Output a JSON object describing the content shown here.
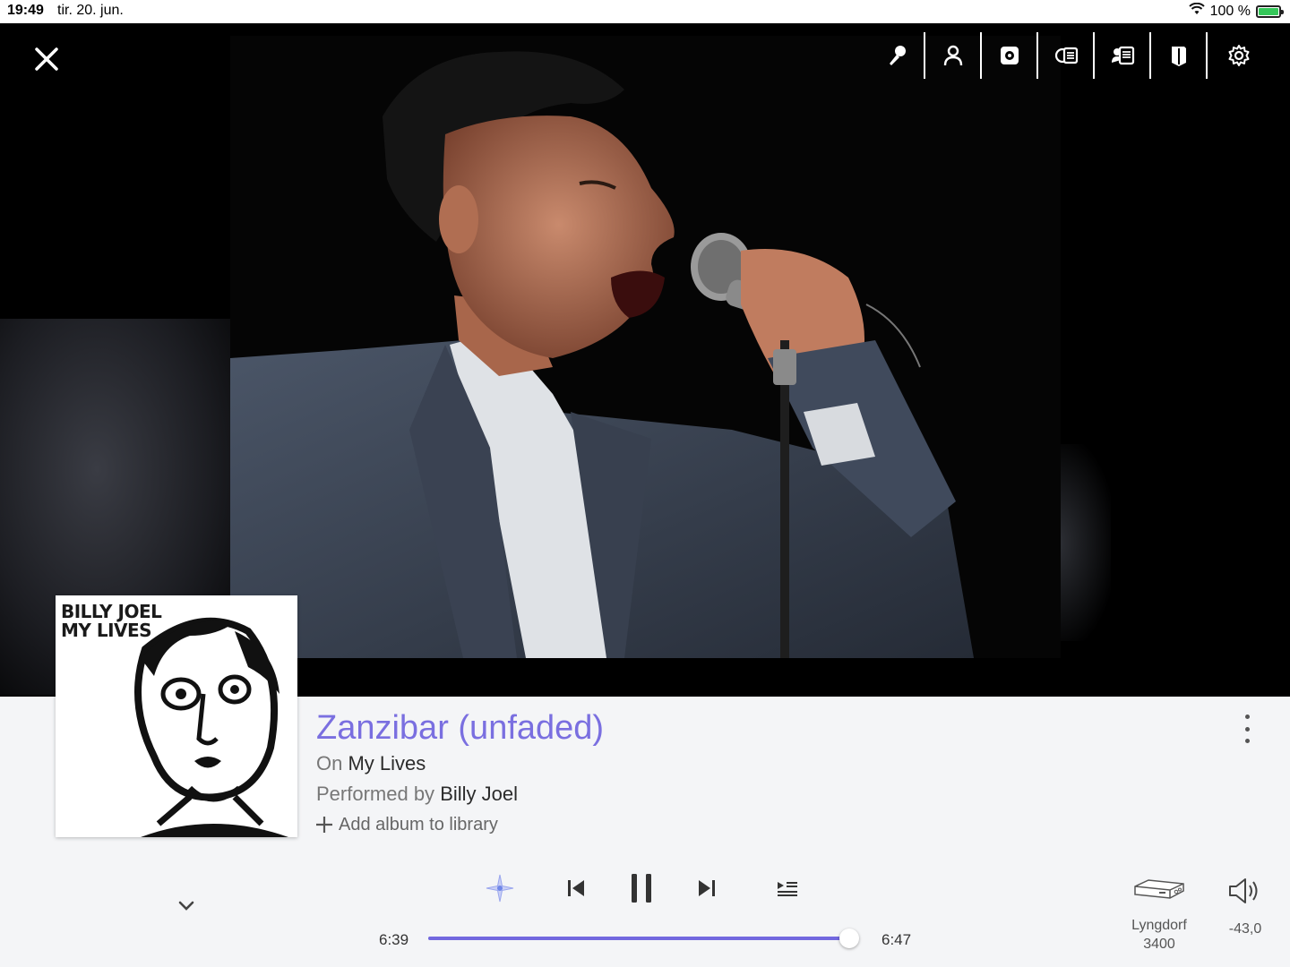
{
  "status_bar": {
    "time": "19:49",
    "date": "tir. 20. jun.",
    "battery_text": "100 %",
    "battery_level": 1.0
  },
  "toolbar": {
    "icons": [
      "microphone-icon",
      "person-icon",
      "speaker-icon",
      "album-info-icon",
      "credits-icon",
      "bookmark-icon",
      "gear-icon"
    ]
  },
  "album_cover": {
    "text_line1": "BILLY JOEL",
    "text_line2": "MY LIVES"
  },
  "track": {
    "title": "Zanzibar (unfaded)",
    "on_prefix": "On",
    "album": "My Lives",
    "performed_prefix": "Performed by",
    "artist": "Billy Joel",
    "add_album_label": "Add album to library"
  },
  "playback": {
    "elapsed": "6:39",
    "total": "6:47",
    "progress": 0.98,
    "state": "playing"
  },
  "output": {
    "device_line1": "Lyngdorf",
    "device_line2": "3400",
    "volume": "-43,0"
  },
  "colors": {
    "accent": "#7a6fe0",
    "progress_fill": "#7268df",
    "background": "#f4f5f7"
  }
}
